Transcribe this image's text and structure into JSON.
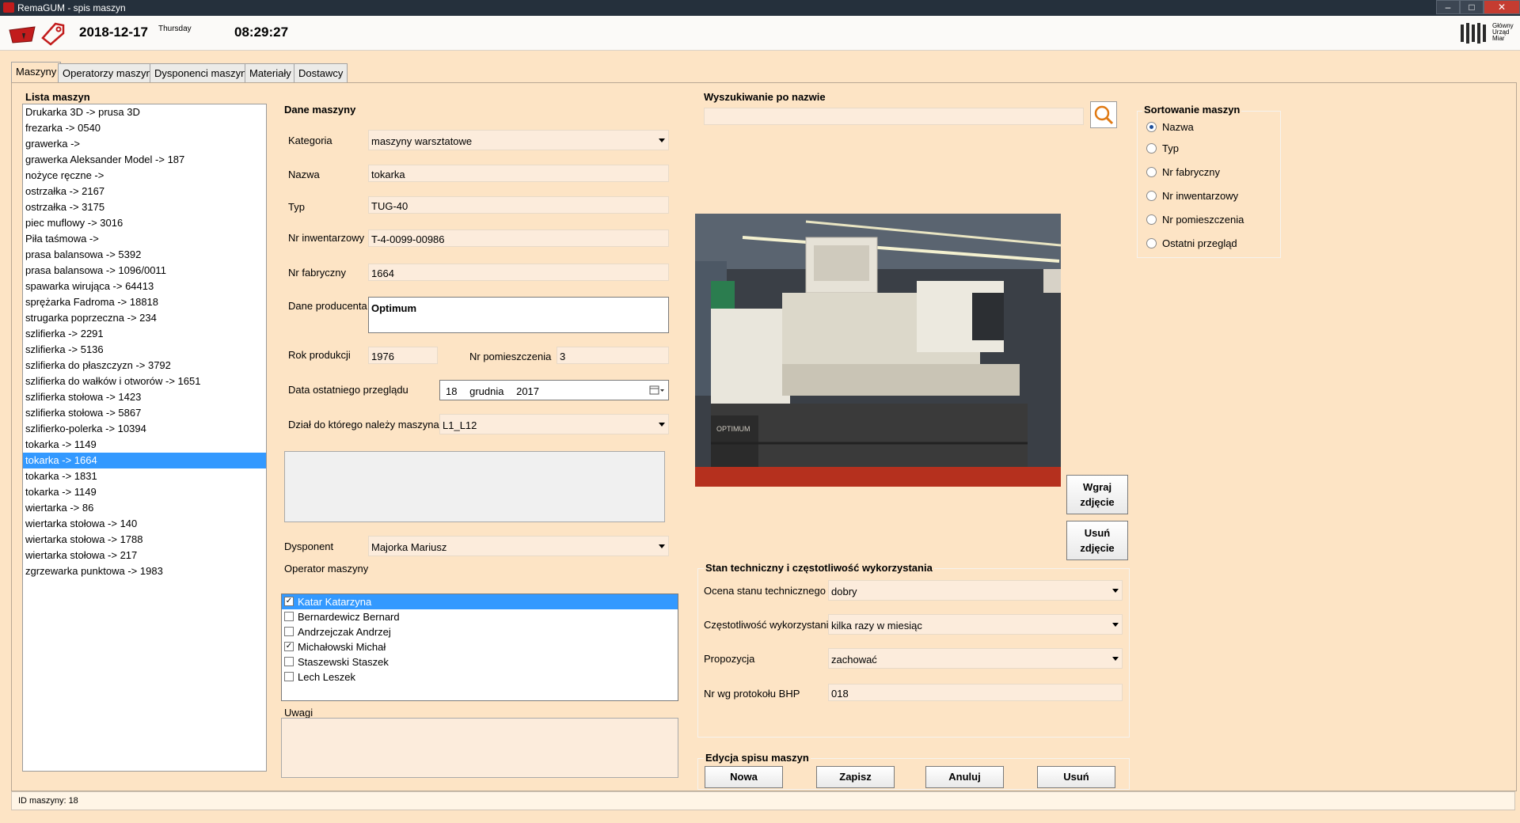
{
  "window": {
    "title": "RemaGUM - spis maszyn",
    "controls": [
      "–",
      "□",
      "✕"
    ]
  },
  "header": {
    "date": "2018-12-17",
    "day_of_week": "Thursday",
    "time": "08:29:27",
    "brand_lines": [
      "Główny",
      "Urząd",
      "Miar"
    ]
  },
  "tabs": [
    "Maszyny",
    "Operatorzy maszyn",
    "Dysponenci maszyn",
    "Materiały",
    "Dostawcy"
  ],
  "machine_list": {
    "title": "Lista maszyn",
    "items": [
      "Drukarka 3D -> prusa 3D",
      "frezarka -> 0540",
      "grawerka ->",
      "grawerka Aleksander Model -> 187",
      "nożyce ręczne ->",
      "ostrzałka -> 2167",
      "ostrzałka -> 3175",
      "piec muflowy -> 3016",
      "Piła taśmowa ->",
      "prasa balansowa -> 5392",
      "prasa balansowa -> 1096/0011",
      "spawarka wirująca -> 64413",
      "sprężarka Fadroma -> 18818",
      "strugarka poprzeczna -> 234",
      "szlifierka -> 2291",
      "szlifierka -> 5136",
      "szlifierka do płaszczyzn -> 3792",
      "szlifierka do wałków i otworów -> 1651",
      "szlifierka stołowa -> 1423",
      "szlifierka stołowa -> 5867",
      "szlifierko-polerka -> 10394",
      "tokarka -> 1149",
      "tokarka -> 1664",
      "tokarka -> 1831",
      "tokarka -> 1149",
      "wiertarka -> 86",
      "wiertarka stołowa -> 140",
      "wiertarka stołowa -> 1788",
      "wiertarka stołowa -> 217",
      "zgrzewarka punktowa -> 1983"
    ],
    "selected_index": 22
  },
  "machine_data": {
    "title": "Dane maszyny",
    "kategoria_label": "Kategoria",
    "kategoria_value": "maszyny warsztatowe",
    "nazwa_label": "Nazwa",
    "nazwa_value": "tokarka",
    "typ_label": "Typ",
    "typ_value": "TUG-40",
    "nr_inw_label": "Nr inwentarzowy",
    "nr_inw_value": "T-4-0099-00986",
    "nr_fab_label": "Nr fabryczny",
    "nr_fab_value": "1664",
    "producent_label": "Dane producenta",
    "producent_value": "Optimum",
    "rok_label": "Rok produkcji",
    "rok_value": "1976",
    "nr_pom_label": "Nr pomieszczenia",
    "nr_pom_value": "3",
    "data_label": "Data ostatniego przeglądu",
    "data_day": "18",
    "data_month": "grudnia",
    "data_year": "2017",
    "dzial_label": "Dział do którego należy maszyna",
    "dzial_value": "L1_L12",
    "dysponent_label": "Dysponent",
    "dysponent_value": "Majorka Mariusz",
    "operator_label": "Operator maszyny",
    "uwagi_label": "Uwagi"
  },
  "operators": [
    {
      "name": "Katar Katarzyna",
      "checked": true,
      "selected": true
    },
    {
      "name": "Bernardewicz Bernard",
      "checked": false,
      "selected": false
    },
    {
      "name": "Andrzejczak Andrzej",
      "checked": false,
      "selected": false
    },
    {
      "name": "Michałowski Michał",
      "checked": true,
      "selected": false
    },
    {
      "name": "Staszewski Staszek",
      "checked": false,
      "selected": false
    },
    {
      "name": "Lech Leszek",
      "checked": false,
      "selected": false
    }
  ],
  "search": {
    "title": "Wyszukiwanie po nazwie",
    "value": ""
  },
  "photo": {
    "load_label_1": "Wgraj",
    "load_label_2": "zdjęcie",
    "remove_label_1": "Usuń",
    "remove_label_2": "zdjęcie",
    "machine_brand_text": "OPTIMUM"
  },
  "sorting": {
    "title": "Sortowanie maszyn",
    "options": [
      "Nazwa",
      "Typ",
      "Nr fabryczny",
      "Nr inwentarzowy",
      "Nr pomieszczenia",
      "Ostatni przegląd"
    ],
    "selected": "Nazwa"
  },
  "tech": {
    "title": "Stan techniczny i częstotliwość wykorzystania",
    "ocena_label": "Ocena stanu technicznego",
    "ocena_value": "dobry",
    "czest_label": "Częstotliwość wykorzystania",
    "czest_value": "kilka razy w miesiąc",
    "prop_label": "Propozycja",
    "prop_value": "zachować",
    "bhp_label": "Nr wg protokołu BHP",
    "bhp_value": "018"
  },
  "edit": {
    "title": "Edycja spisu maszyn",
    "new": "Nowa",
    "save": "Zapisz",
    "cancel": "Anuluj",
    "delete": "Usuń"
  },
  "status": {
    "id_text": "ID maszyny:  18"
  }
}
